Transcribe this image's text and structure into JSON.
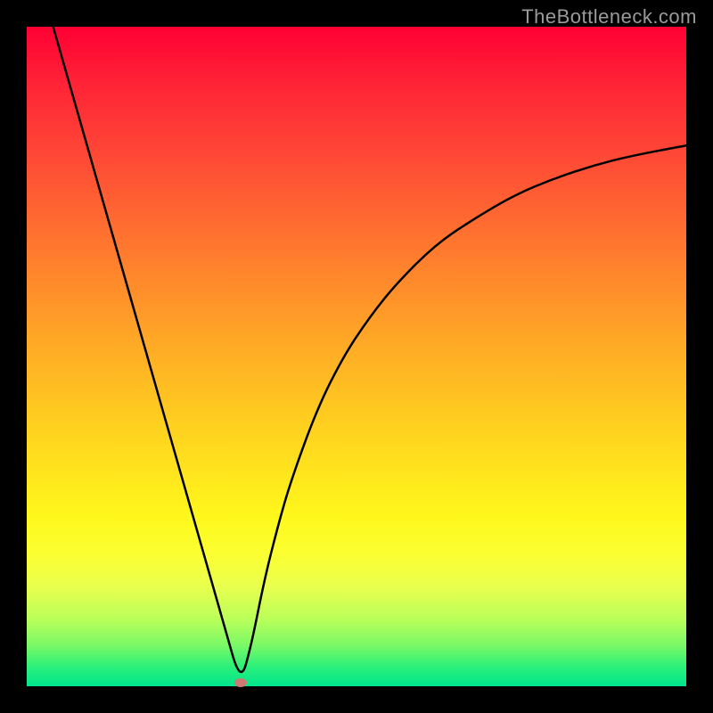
{
  "attribution": "TheBottleneck.com",
  "chart_data": {
    "type": "line",
    "title": "",
    "xlabel": "",
    "ylabel": "",
    "xlim": [
      0,
      100
    ],
    "ylim": [
      0,
      100
    ],
    "series": [
      {
        "name": "bottleneck-curve",
        "x": [
          4,
          6,
          8,
          10,
          12,
          14,
          16,
          18,
          20,
          22,
          24,
          26,
          28,
          30,
          32.4,
          34,
          36,
          38,
          40,
          44,
          48,
          52,
          56,
          62,
          68,
          74,
          80,
          86,
          92,
          100
        ],
        "y": [
          100,
          93,
          86,
          79,
          72,
          65,
          58,
          51,
          44,
          37,
          30,
          23,
          16,
          9,
          0.5,
          6,
          16,
          24,
          31,
          42,
          50,
          56,
          61,
          67,
          71,
          74.5,
          77,
          79,
          80.5,
          82
        ]
      }
    ],
    "nadir": {
      "x": 32.4,
      "y": 0.5
    },
    "gradient_stops": [
      {
        "pos": 0,
        "color": "#ff0033"
      },
      {
        "pos": 50,
        "color": "#ffb020"
      },
      {
        "pos": 75,
        "color": "#fff71b"
      },
      {
        "pos": 100,
        "color": "#00e58c"
      }
    ]
  }
}
